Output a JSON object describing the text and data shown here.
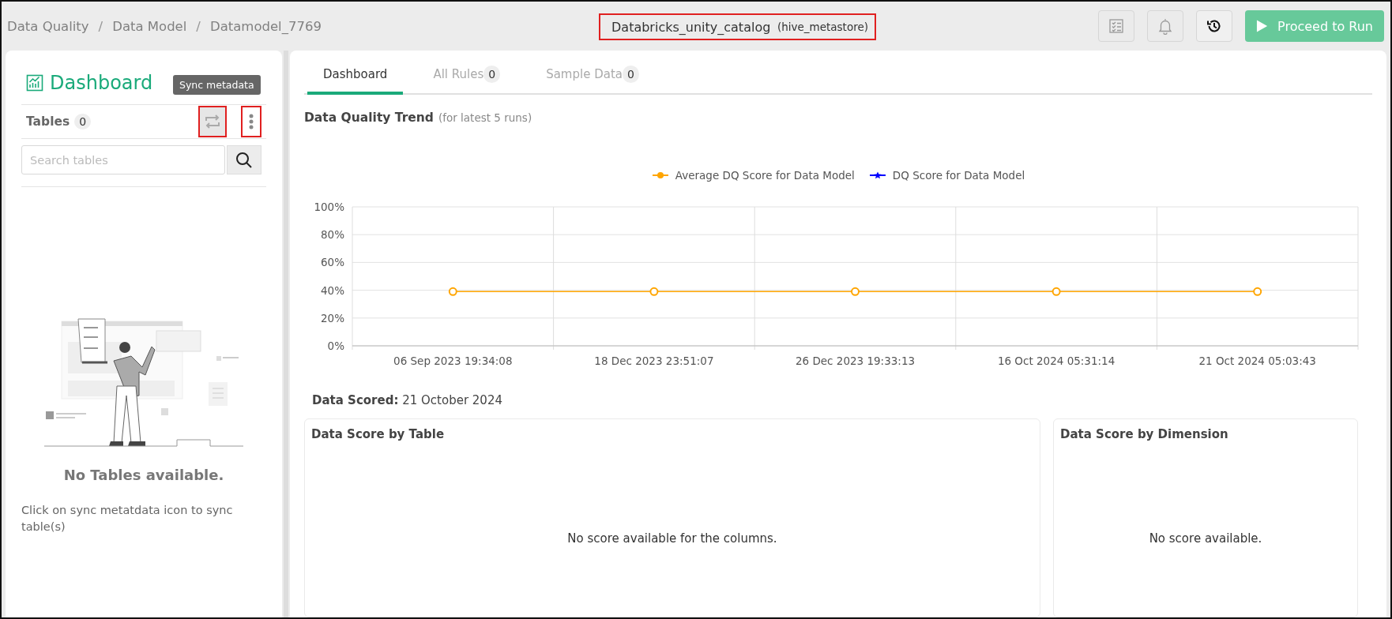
{
  "breadcrumb": [
    {
      "kind": "link",
      "text": "Data Quality"
    },
    {
      "kind": "separator",
      "text": "/"
    },
    {
      "kind": "link",
      "text": "Data Model"
    },
    {
      "kind": "separator",
      "text": "/"
    },
    {
      "kind": "current",
      "text": "Datamodel_7769"
    }
  ],
  "catalog": {
    "name": "Databricks_unity_catalog",
    "schema": "(hive_metastore)",
    "highlighted": true
  },
  "toolbar": {
    "icon_buttons": [
      {
        "kind": "checklist",
        "disabled": true
      },
      {
        "kind": "bell",
        "disabled": true
      },
      {
        "kind": "history",
        "disabled": false
      }
    ],
    "run_button": "Proceed to Run"
  },
  "sidebar": {
    "title": "Dashboard",
    "tooltip": "Sync metadata",
    "tables_label": "Tables",
    "tables_count": "0",
    "sync_highlighted": true,
    "menu_highlighted": true,
    "search_placeholder": "Search tables",
    "empty_title": "No Tables available.",
    "empty_text": "Click on sync metatdata icon to sync table(s)"
  },
  "tabs": [
    {
      "label": "Dashboard",
      "selected": true
    },
    {
      "label": "All Rules",
      "count": "0",
      "selected": false
    },
    {
      "label": "Sample Data",
      "count": "0",
      "selected": false
    }
  ],
  "trend": {
    "title": "Data Quality Trend",
    "subtitle": "(for latest 5 runs)",
    "chart_data": {
      "type": "line",
      "categories": [
        "06 Sep 2023 19:34:08",
        "18 Dec 2023 23:51:07",
        "26 Dec 2023 19:33:13",
        "16 Oct 2024 05:31:14",
        "21 Oct 2024 05:03:43"
      ],
      "series": [
        {
          "name": "Average DQ Score for Data Model",
          "color": "#ffa500",
          "marker": "circle",
          "values": [
            39,
            39,
            39,
            39,
            39
          ]
        },
        {
          "name": "DQ Score for Data Model",
          "color": "#0000ff",
          "marker": "star",
          "values": [
            null,
            null,
            null,
            null,
            null
          ]
        }
      ],
      "grid": true,
      "ylim": [
        0,
        100
      ],
      "yticks": [
        {
          "value": 0,
          "label": "0%"
        },
        {
          "value": 20,
          "label": "20%"
        },
        {
          "value": 40,
          "label": "40%"
        },
        {
          "value": 60,
          "label": "60%"
        },
        {
          "value": 80,
          "label": "80%"
        },
        {
          "value": 100,
          "label": "100%"
        }
      ]
    }
  },
  "data_scored": {
    "label": "Data Scored:",
    "value": "21 October 2024"
  },
  "cards": [
    {
      "title": "Data Score by Table",
      "message": "No score available for the columns."
    },
    {
      "title": "Data Score by Dimension",
      "message": "No score available."
    }
  ]
}
